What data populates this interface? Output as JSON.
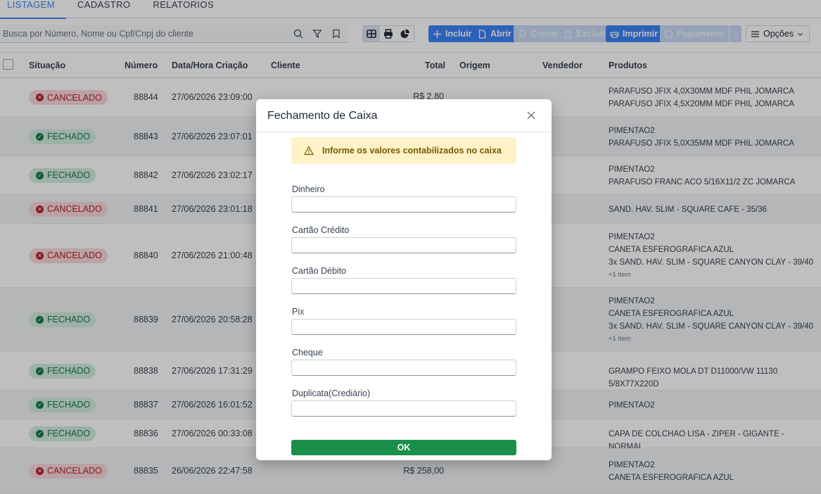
{
  "tabs": [
    {
      "label": "LISTAGEM",
      "active": true
    },
    {
      "label": "CADASTRO",
      "active": false
    },
    {
      "label": "RELATORIOS",
      "active": false
    }
  ],
  "search": {
    "placeholder": "Busca por Número, Nome ou Cpf/Cnpj do cliente",
    "value": ""
  },
  "toolbar": {
    "incluir": "Incluir",
    "abrir": "Abrir",
    "clonar": "Clonar",
    "excluir": "Excluir",
    "imprimir": "Imprimir",
    "pagamento": "Pagamento",
    "opcoes": "Opções"
  },
  "table": {
    "headers": {
      "situacao": "Situação",
      "numero": "Número",
      "data": "Data/Hora Criação",
      "cliente": "Cliente",
      "total": "Total",
      "origem": "Origem",
      "vendedor": "Vendedor",
      "produtos": "Produtos"
    },
    "rows": [
      {
        "status": "CANCELADO",
        "numero": "88844",
        "data": "27/06/2026 23:09:00",
        "total": "R$ 2,80",
        "produtos": [
          "PARAFUSO JFIX 4,0X30MM MDF PHIL JOMARCA",
          "PARAFUSO JFIX 4,5X20MM MDF PHIL JOMARCA"
        ],
        "more": ""
      },
      {
        "status": "FECHADO",
        "numero": "88843",
        "data": "27/06/2026 23:07:01",
        "total": "",
        "produtos": [
          "PIMENTAO2",
          "PARAFUSO JFIX 5,0X35MM MDF PHIL JOMARCA"
        ],
        "more": ""
      },
      {
        "status": "FECHADO",
        "numero": "88842",
        "data": "27/06/2026 23:02:17",
        "total": "",
        "produtos": [
          "PIMENTAO2",
          "PARAFUSO FRANC ACO 5/16X11/2 ZC JOMARCA"
        ],
        "more": ""
      },
      {
        "status": "CANCELADO",
        "numero": "88841",
        "data": "27/06/2026 23:01:18",
        "total": "",
        "produtos": [
          "SAND. HAV. SLIM - SQUARE CAFE - 35/36"
        ],
        "more": ""
      },
      {
        "status": "CANCELADO",
        "numero": "88840",
        "data": "27/06/2026 21:00:48",
        "total": "",
        "produtos": [
          "PIMENTAO2",
          "CANETA ESFEROGRAFICA AZUL",
          "3x SAND. HAV. SLIM - SQUARE CANYON CLAY - 39/40"
        ],
        "more": "+1 item"
      },
      {
        "status": "FECHADO",
        "numero": "88839",
        "data": "27/06/2026 20:58:28",
        "total": "",
        "produtos": [
          "PIMENTAO2",
          "CANETA ESFEROGRAFICA AZUL",
          "3x SAND. HAV. SLIM - SQUARE CANYON CLAY - 39/40"
        ],
        "more": "+1 item"
      },
      {
        "status": "FECHADO",
        "numero": "88838",
        "data": "27/06/2026 17:31:29",
        "total": "",
        "produtos": [
          "GRAMPO FEIXO MOLA DT D11000/VW 11130 5/8X77X220D"
        ],
        "more": ""
      },
      {
        "status": "FECHADO",
        "numero": "88837",
        "data": "27/06/2026 16:01:52",
        "total": "",
        "produtos": [
          "PIMENTAO2"
        ],
        "more": ""
      },
      {
        "status": "FECHADO",
        "numero": "88836",
        "data": "27/06/2026 00:33:08",
        "total": "",
        "produtos": [
          "CAPA DE COLCHAO LISA - ZIPER - GIGANTE - NORMAL"
        ],
        "more": ""
      },
      {
        "status": "CANCELADO",
        "numero": "88835",
        "data": "26/06/2026 22:47:58",
        "total": "R$ 258,00",
        "produtos": [
          "PIMENTAO2",
          "CANETA ESFEROGRAFICA AZUL"
        ],
        "more": ""
      }
    ]
  },
  "modal": {
    "title": "Fechamento de Caixa",
    "alert": "Informe os valores contabilizados no caixa",
    "fields": [
      {
        "label": "Dinheiro",
        "value": ""
      },
      {
        "label": "Cartão Crédito",
        "value": ""
      },
      {
        "label": "Cartão Débito",
        "value": ""
      },
      {
        "label": "Pix",
        "value": ""
      },
      {
        "label": "Cheque",
        "value": ""
      },
      {
        "label": "Duplicata(Crediário)",
        "value": ""
      }
    ],
    "ok_label": "OK"
  },
  "colors": {
    "accent": "#3b82f6",
    "cancel": "#b42331",
    "closed": "#187a4a",
    "ok": "#1a8f4a",
    "alert_bg": "#fdf2c8"
  }
}
